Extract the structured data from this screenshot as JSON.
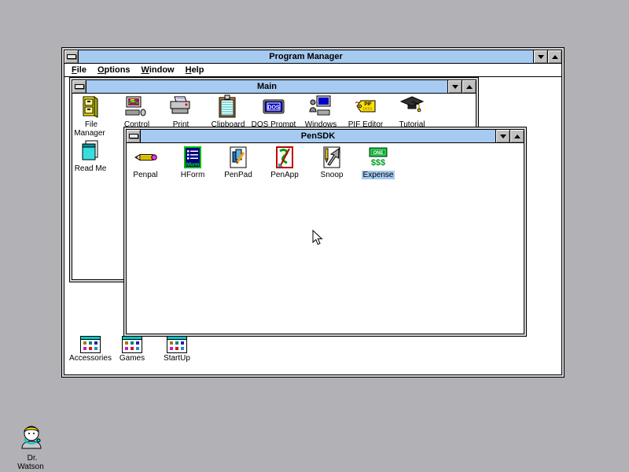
{
  "colors": {
    "titlebar": "#a6caf0",
    "desktop_gray": "#b1b1b6",
    "selection": "#a6caf0"
  },
  "program_manager": {
    "title": "Program Manager",
    "menu": [
      {
        "label": "File"
      },
      {
        "label": "Options"
      },
      {
        "label": "Window"
      },
      {
        "label": "Help"
      }
    ]
  },
  "main_group": {
    "title": "Main",
    "items": [
      {
        "label": "File Manager"
      },
      {
        "label": "Control Panel"
      },
      {
        "label": "Print Manager"
      },
      {
        "label": "Clipboard Viewer"
      },
      {
        "label": "DOS Prompt"
      },
      {
        "label": "Windows Setup"
      },
      {
        "label": "PIF Editor"
      },
      {
        "label": "Tutorial"
      },
      {
        "label": "Read Me"
      }
    ]
  },
  "pensdk_group": {
    "title": "PenSDK",
    "items": [
      {
        "label": "Penpal"
      },
      {
        "label": "HForm"
      },
      {
        "label": "PenPad"
      },
      {
        "label": "PenApp"
      },
      {
        "label": "Snoop"
      },
      {
        "label": "Expense",
        "selected": true
      }
    ]
  },
  "minimized_groups": [
    {
      "label": "Accessories"
    },
    {
      "label": "Games"
    },
    {
      "label": "StartUp"
    }
  ],
  "desktop_icons": [
    {
      "label": "Dr. Watson"
    }
  ]
}
